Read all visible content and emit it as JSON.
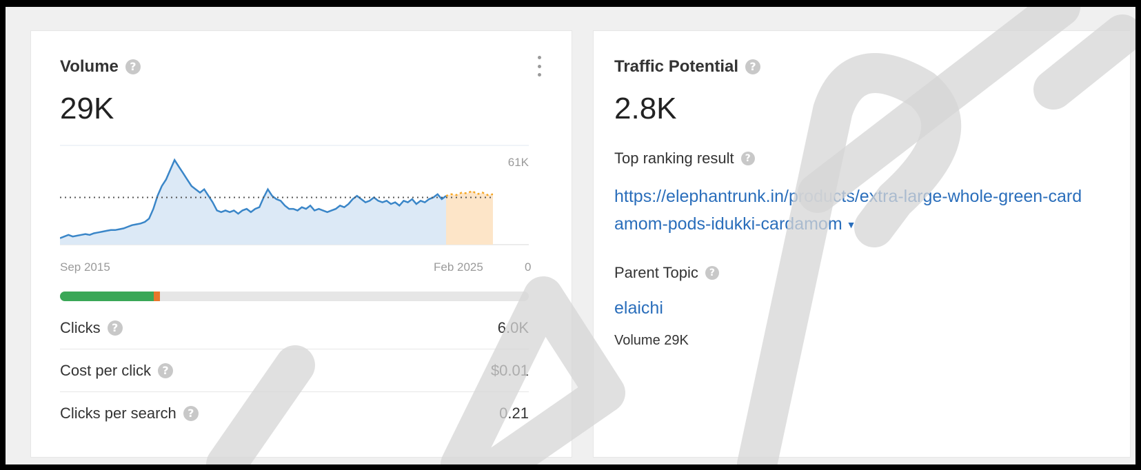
{
  "volume_card": {
    "title": "Volume",
    "value": "29K",
    "y_max_label": "61K",
    "y_min_label": "0",
    "x_start_label": "Sep 2015",
    "x_end_label": "Feb 2025",
    "clicks_ratio": {
      "green_fraction": 0.2,
      "orange_fraction": 0.013
    },
    "metrics": [
      {
        "label": "Clicks",
        "value": "6.0K"
      },
      {
        "label": "Cost per click",
        "value": "$0.01"
      },
      {
        "label": "Clicks per search",
        "value": "0.21"
      }
    ]
  },
  "traffic_card": {
    "title": "Traffic Potential",
    "value": "2.8K",
    "top_result_label": "Top ranking result",
    "top_result_url": "https://elephantrunk.in/products/extra-large-whole-green-cardamom-pods-idukki-cardamom",
    "parent_topic_label": "Parent Topic",
    "parent_topic": "elaichi",
    "parent_topic_volume": "Volume 29K"
  },
  "colors": {
    "line": "#3a86c8",
    "area": "#dce9f6",
    "forecast": "#f5a623",
    "forecast_area": "#fde5c8",
    "link": "#2a6ebb",
    "green": "#3aa757",
    "orange": "#e8762c"
  },
  "chart_data": {
    "type": "area",
    "title": "",
    "xlabel": "",
    "ylabel": "",
    "ylim": [
      0,
      61000
    ],
    "x_range": [
      "Sep 2015",
      "Feb 2025"
    ],
    "average_line": 29000,
    "series": [
      {
        "values": [
          4000,
          5000,
          6000,
          5000,
          5500,
          6000,
          6500,
          6000,
          7000,
          7500,
          8000,
          8500,
          9000,
          9000,
          9500,
          10000,
          11000,
          12000,
          12500,
          13000,
          14000,
          16000,
          22000,
          30000,
          36000,
          40000,
          46000,
          52000,
          48000,
          44000,
          40000,
          36000,
          34000,
          32000,
          34000,
          30000,
          26000,
          21000,
          20000,
          21000,
          20000,
          21000,
          19000,
          21000,
          22000,
          20000,
          22000,
          23000,
          29000,
          34000,
          30000,
          28000,
          27000,
          24000,
          22000,
          22000,
          21000,
          23000,
          22000,
          24000,
          21000,
          22000,
          21000,
          20000,
          21000,
          22000,
          24000,
          23000,
          25000,
          28000,
          30000,
          28000,
          26000,
          27000,
          29000,
          27000,
          26000,
          27000,
          25000,
          26000,
          24000,
          27000,
          26000,
          28000,
          25000,
          27000,
          26000,
          28000,
          29000,
          31000,
          28000,
          30000
        ]
      },
      {
        "name": "forecast",
        "values": [
          30000,
          31000,
          30500,
          32000,
          31500,
          33000,
          31000,
          32000,
          30500,
          31000
        ]
      }
    ]
  }
}
